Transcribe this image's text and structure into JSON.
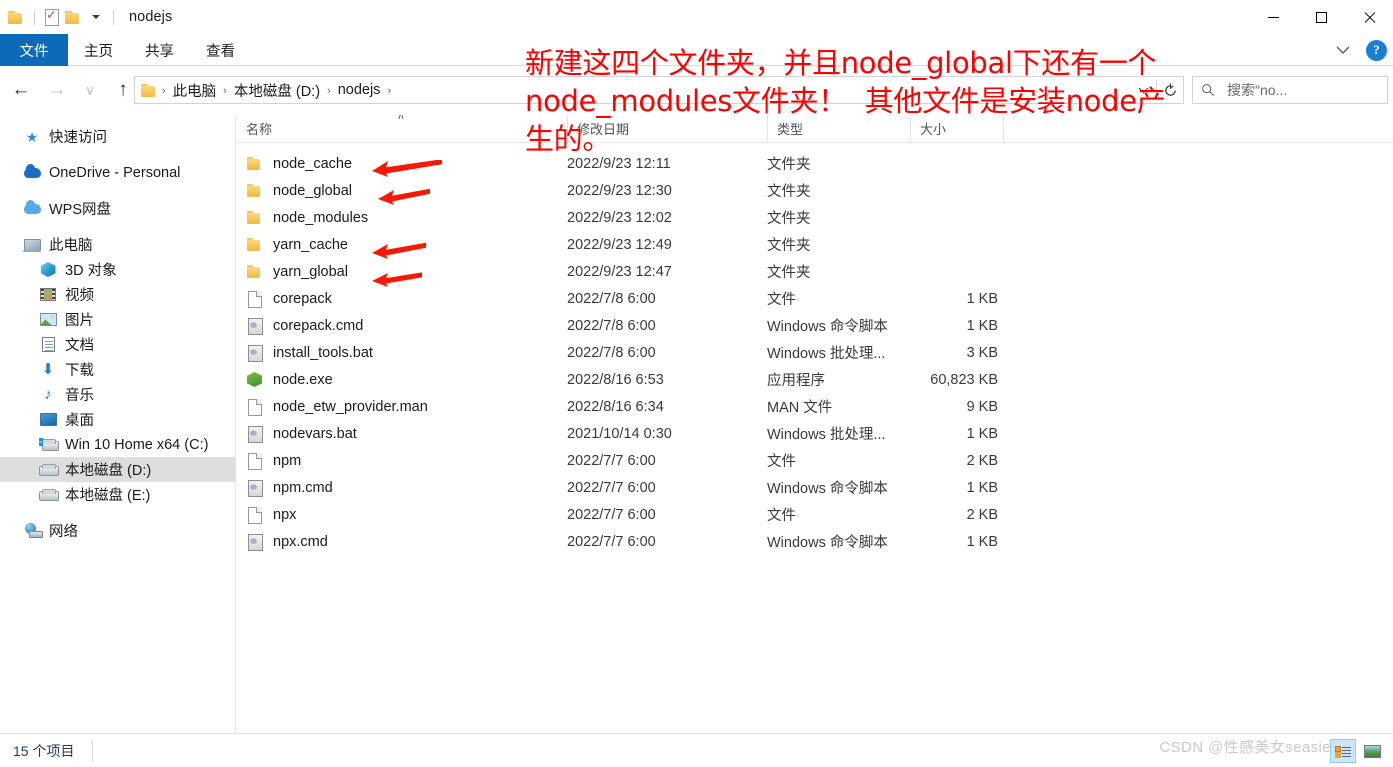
{
  "window": {
    "title": "nodejs",
    "quick_access_icons": [
      "folder-icon",
      "properties-icon",
      "new-folder-icon"
    ],
    "controls": {
      "minimize": "—",
      "maximize": "□",
      "close": "✕"
    }
  },
  "ribbon": {
    "tabs": [
      {
        "label": "文件",
        "active": true
      },
      {
        "label": "主页",
        "active": false
      },
      {
        "label": "共享",
        "active": false
      },
      {
        "label": "查看",
        "active": false
      }
    ],
    "expand_icon": "chevron-down-icon",
    "help_label": "?"
  },
  "navigation": {
    "back": "←",
    "forward": "→",
    "recent": "∨",
    "up": "↑",
    "breadcrumbs": [
      "此电脑",
      "本地磁盘 (D:)",
      "nodejs"
    ],
    "separator": "›",
    "dropdown_icon": "chevron-down-icon",
    "refresh_icon": "refresh-icon"
  },
  "search": {
    "placeholder": "搜索\"no...",
    "icon": "search-icon"
  },
  "sidebar": {
    "items": [
      {
        "label": "快速访问",
        "icon": "star-icon",
        "indent": 0,
        "selected": false,
        "gap_before": false
      },
      {
        "label": "OneDrive - Personal",
        "icon": "cloud-icon",
        "indent": 0,
        "selected": false,
        "gap_before": true
      },
      {
        "label": "WPS网盘",
        "icon": "wps-cloud-icon",
        "indent": 0,
        "selected": false,
        "gap_before": true
      },
      {
        "label": "此电脑",
        "icon": "this-pc-icon",
        "indent": 0,
        "selected": false,
        "gap_before": true
      },
      {
        "label": "3D 对象",
        "icon": "3d-objects-icon",
        "indent": 1,
        "selected": false,
        "gap_before": false
      },
      {
        "label": "视频",
        "icon": "videos-icon",
        "indent": 1,
        "selected": false,
        "gap_before": false
      },
      {
        "label": "图片",
        "icon": "pictures-icon",
        "indent": 1,
        "selected": false,
        "gap_before": false
      },
      {
        "label": "文档",
        "icon": "documents-icon",
        "indent": 1,
        "selected": false,
        "gap_before": false
      },
      {
        "label": "下载",
        "icon": "downloads-icon",
        "indent": 1,
        "selected": false,
        "gap_before": false
      },
      {
        "label": "音乐",
        "icon": "music-icon",
        "indent": 1,
        "selected": false,
        "gap_before": false
      },
      {
        "label": "桌面",
        "icon": "desktop-icon",
        "indent": 1,
        "selected": false,
        "gap_before": false
      },
      {
        "label": "Win 10 Home x64 (C:)",
        "icon": "windows-drive-icon",
        "indent": 1,
        "selected": false,
        "gap_before": false
      },
      {
        "label": "本地磁盘 (D:)",
        "icon": "drive-icon",
        "indent": 1,
        "selected": true,
        "gap_before": false
      },
      {
        "label": "本地磁盘 (E:)",
        "icon": "drive-icon",
        "indent": 1,
        "selected": false,
        "gap_before": false
      },
      {
        "label": "网络",
        "icon": "network-icon",
        "indent": 0,
        "selected": false,
        "gap_before": true
      }
    ]
  },
  "file_list": {
    "columns": [
      "名称",
      "修改日期",
      "类型",
      "大小"
    ],
    "sort_indicator": "∧",
    "rows": [
      {
        "name": "node_cache",
        "date": "2022/9/23 12:11",
        "type": "文件夹",
        "size": "",
        "icon": "folder-icon",
        "arrow": true
      },
      {
        "name": "node_global",
        "date": "2022/9/23 12:30",
        "type": "文件夹",
        "size": "",
        "icon": "folder-icon",
        "arrow": true
      },
      {
        "name": "node_modules",
        "date": "2022/9/23 12:02",
        "type": "文件夹",
        "size": "",
        "icon": "folder-icon",
        "arrow": false
      },
      {
        "name": "yarn_cache",
        "date": "2022/9/23 12:49",
        "type": "文件夹",
        "size": "",
        "icon": "folder-icon",
        "arrow": true
      },
      {
        "name": "yarn_global",
        "date": "2022/9/23 12:47",
        "type": "文件夹",
        "size": "",
        "icon": "folder-icon",
        "arrow": true
      },
      {
        "name": "corepack",
        "date": "2022/7/8 6:00",
        "type": "文件",
        "size": "1 KB",
        "icon": "file-icon",
        "arrow": false
      },
      {
        "name": "corepack.cmd",
        "date": "2022/7/8 6:00",
        "type": "Windows 命令脚本",
        "size": "1 KB",
        "icon": "script-icon",
        "arrow": false
      },
      {
        "name": "install_tools.bat",
        "date": "2022/7/8 6:00",
        "type": "Windows 批处理...",
        "size": "3 KB",
        "icon": "script-icon",
        "arrow": false
      },
      {
        "name": "node.exe",
        "date": "2022/8/16 6:53",
        "type": "应用程序",
        "size": "60,823 KB",
        "icon": "node-icon",
        "arrow": false
      },
      {
        "name": "node_etw_provider.man",
        "date": "2022/8/16 6:34",
        "type": "MAN 文件",
        "size": "9 KB",
        "icon": "file-icon",
        "arrow": false
      },
      {
        "name": "nodevars.bat",
        "date": "2021/10/14 0:30",
        "type": "Windows 批处理...",
        "size": "1 KB",
        "icon": "script-icon",
        "arrow": false
      },
      {
        "name": "npm",
        "date": "2022/7/7 6:00",
        "type": "文件",
        "size": "2 KB",
        "icon": "file-icon",
        "arrow": false
      },
      {
        "name": "npm.cmd",
        "date": "2022/7/7 6:00",
        "type": "Windows 命令脚本",
        "size": "1 KB",
        "icon": "script-icon",
        "arrow": false
      },
      {
        "name": "npx",
        "date": "2022/7/7 6:00",
        "type": "文件",
        "size": "2 KB",
        "icon": "file-icon",
        "arrow": false
      },
      {
        "name": "npx.cmd",
        "date": "2022/7/7 6:00",
        "type": "Windows 命令脚本",
        "size": "1 KB",
        "icon": "script-icon",
        "arrow": false
      }
    ]
  },
  "annotation": {
    "text": "新建这四个文件夹，并且node_global下还有一个\nnode_modules文件夹！  其他文件是安装node产\n生的。",
    "color": "#ff0000",
    "arrow_color": "#fa1802"
  },
  "status": {
    "item_count": "15 个项目",
    "view_details_icon": "details-view-icon",
    "view_large_icons_icon": "large-icons-view-icon"
  },
  "watermark": {
    "text": "CSDN @性感美女seasie"
  },
  "colors": {
    "accent": "#0d6ab8",
    "folder": "#efb73c",
    "selection": "#dedede",
    "annotation_red": "#ff0000",
    "node_green": "#3e8b2e"
  }
}
